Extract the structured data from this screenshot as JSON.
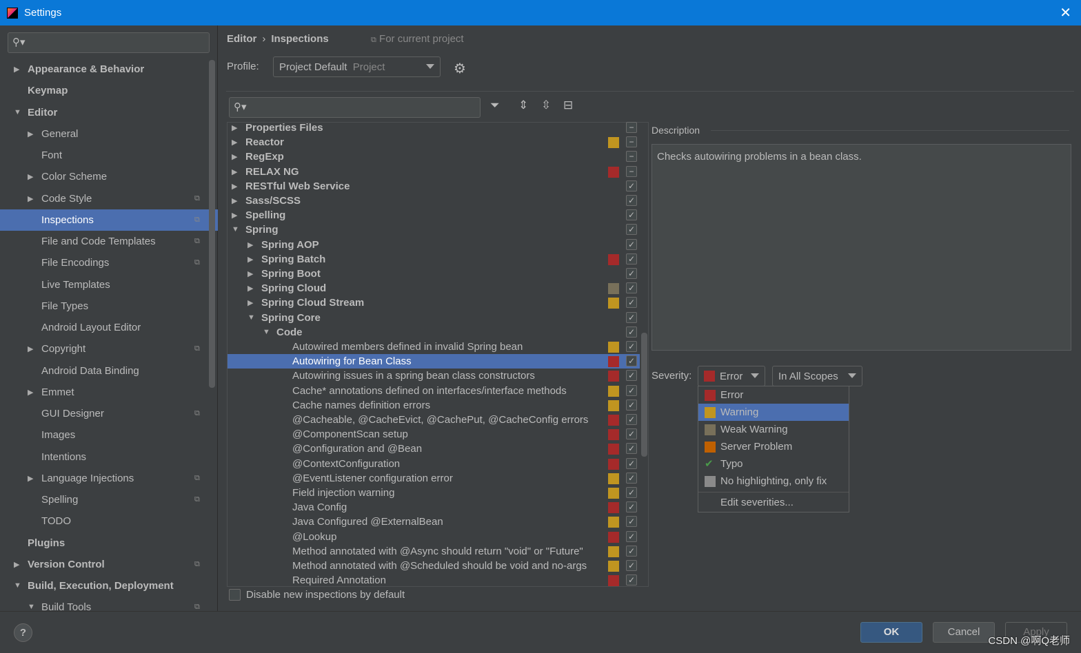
{
  "window": {
    "title": "Settings"
  },
  "colors": {
    "error": "#a52a2a",
    "warning": "#c09520",
    "weak_warning": "#78705a",
    "server_problem": "#c06000",
    "no_highlight": "#8a8a8a",
    "typo": "#4a9a4a",
    "selection": "#4b6eaf",
    "titlebar": "#0a78d7"
  },
  "sidebar": {
    "items": [
      {
        "label": "Appearance & Behavior",
        "level": 0,
        "arrow": "right",
        "bold": true
      },
      {
        "label": "Keymap",
        "level": 0,
        "bold": true
      },
      {
        "label": "Editor",
        "level": 0,
        "arrow": "down",
        "bold": true
      },
      {
        "label": "General",
        "level": 1,
        "arrow": "right"
      },
      {
        "label": "Font",
        "level": 1
      },
      {
        "label": "Color Scheme",
        "level": 1,
        "arrow": "right"
      },
      {
        "label": "Code Style",
        "level": 1,
        "arrow": "right",
        "project": true
      },
      {
        "label": "Inspections",
        "level": 1,
        "project": true,
        "selected": true
      },
      {
        "label": "File and Code Templates",
        "level": 1,
        "project": true
      },
      {
        "label": "File Encodings",
        "level": 1,
        "project": true
      },
      {
        "label": "Live Templates",
        "level": 1
      },
      {
        "label": "File Types",
        "level": 1
      },
      {
        "label": "Android Layout Editor",
        "level": 1
      },
      {
        "label": "Copyright",
        "level": 1,
        "arrow": "right",
        "project": true
      },
      {
        "label": "Android Data Binding",
        "level": 1
      },
      {
        "label": "Emmet",
        "level": 1,
        "arrow": "right"
      },
      {
        "label": "GUI Designer",
        "level": 1,
        "project": true
      },
      {
        "label": "Images",
        "level": 1
      },
      {
        "label": "Intentions",
        "level": 1
      },
      {
        "label": "Language Injections",
        "level": 1,
        "arrow": "right",
        "project": true
      },
      {
        "label": "Spelling",
        "level": 1,
        "project": true
      },
      {
        "label": "TODO",
        "level": 1
      },
      {
        "label": "Plugins",
        "level": 0,
        "bold": true
      },
      {
        "label": "Version Control",
        "level": 0,
        "arrow": "right",
        "bold": true,
        "project": true
      },
      {
        "label": "Build, Execution, Deployment",
        "level": 0,
        "arrow": "down",
        "bold": true
      },
      {
        "label": "Build Tools",
        "level": 1,
        "arrow": "down",
        "project": true
      }
    ]
  },
  "header": {
    "breadcrumb": [
      "Editor",
      "Inspections"
    ],
    "for_project": "For current project",
    "profile_label": "Profile:",
    "profile_value": "Project Default",
    "profile_scope": "Project"
  },
  "tree": {
    "rows": [
      {
        "label": "Properties Files",
        "level": 0,
        "arrow": "right",
        "bold": true,
        "check": "minus"
      },
      {
        "label": "Reactor",
        "level": 0,
        "arrow": "right",
        "bold": true,
        "sev": "warning",
        "check": "minus"
      },
      {
        "label": "RegExp",
        "level": 0,
        "arrow": "right",
        "bold": true,
        "check": "minus"
      },
      {
        "label": "RELAX NG",
        "level": 0,
        "arrow": "right",
        "bold": true,
        "sev": "error",
        "check": "minus"
      },
      {
        "label": "RESTful Web Service",
        "level": 0,
        "arrow": "right",
        "bold": true,
        "check": "checked"
      },
      {
        "label": "Sass/SCSS",
        "level": 0,
        "arrow": "right",
        "bold": true,
        "check": "checked"
      },
      {
        "label": "Spelling",
        "level": 0,
        "arrow": "right",
        "bold": true,
        "check": "checked"
      },
      {
        "label": "Spring",
        "level": 0,
        "arrow": "down",
        "bold": true,
        "check": "checked"
      },
      {
        "label": "Spring AOP",
        "level": 1,
        "arrow": "right",
        "bold": true,
        "check": "checked"
      },
      {
        "label": "Spring Batch",
        "level": 1,
        "arrow": "right",
        "bold": true,
        "sev": "error",
        "check": "checked"
      },
      {
        "label": "Spring Boot",
        "level": 1,
        "arrow": "right",
        "bold": true,
        "check": "checked"
      },
      {
        "label": "Spring Cloud",
        "level": 1,
        "arrow": "right",
        "bold": true,
        "sev": "weak_warning",
        "check": "checked"
      },
      {
        "label": "Spring Cloud Stream",
        "level": 1,
        "arrow": "right",
        "bold": true,
        "sev": "warning",
        "check": "checked"
      },
      {
        "label": "Spring Core",
        "level": 1,
        "arrow": "down",
        "bold": true,
        "check": "checked"
      },
      {
        "label": "Code",
        "level": 2,
        "arrow": "down",
        "bold": true,
        "check": "checked"
      },
      {
        "label": "Autowired members defined in invalid Spring bean",
        "level": 3,
        "sev": "warning",
        "check": "checked"
      },
      {
        "label": "Autowiring for Bean Class",
        "level": 3,
        "sev": "error",
        "check": "checked",
        "selected": true
      },
      {
        "label": "Autowiring issues in a spring bean class constructors",
        "level": 3,
        "sev": "error",
        "check": "checked"
      },
      {
        "label": "Cache* annotations defined on interfaces/interface methods",
        "level": 3,
        "sev": "warning",
        "check": "checked"
      },
      {
        "label": "Cache names definition errors",
        "level": 3,
        "sev": "warning",
        "check": "checked"
      },
      {
        "label": "@Cacheable, @CacheEvict, @CachePut, @CacheConfig errors",
        "level": 3,
        "sev": "error",
        "check": "checked"
      },
      {
        "label": "@ComponentScan setup",
        "level": 3,
        "sev": "error",
        "check": "checked"
      },
      {
        "label": "@Configuration and @Bean",
        "level": 3,
        "sev": "error",
        "check": "checked"
      },
      {
        "label": "@ContextConfiguration",
        "level": 3,
        "sev": "error",
        "check": "checked"
      },
      {
        "label": "@EventListener configuration error",
        "level": 3,
        "sev": "warning",
        "check": "checked"
      },
      {
        "label": "Field injection warning",
        "level": 3,
        "sev": "warning",
        "check": "checked"
      },
      {
        "label": "Java Config",
        "level": 3,
        "sev": "error",
        "check": "checked"
      },
      {
        "label": "Java Configured @ExternalBean",
        "level": 3,
        "sev": "warning",
        "check": "checked"
      },
      {
        "label": "@Lookup",
        "level": 3,
        "sev": "error",
        "check": "checked"
      },
      {
        "label": "Method annotated with @Async should return \"void\" or \"Future\"",
        "level": 3,
        "sev": "warning",
        "check": "checked"
      },
      {
        "label": "Method annotated with @Scheduled should be void and no-args",
        "level": 3,
        "sev": "warning",
        "check": "checked"
      },
      {
        "label": "Required Annotation",
        "level": 3,
        "sev": "error",
        "check": "checked"
      }
    ]
  },
  "description": {
    "title": "Description",
    "text": "Checks autowiring problems in a bean class."
  },
  "severity": {
    "label": "Severity:",
    "value": "Error",
    "scope": "In All Scopes",
    "options": [
      {
        "label": "Error",
        "sev": "error"
      },
      {
        "label": "Warning",
        "sev": "warning",
        "highlighted": true
      },
      {
        "label": "Weak Warning",
        "sev": "weak_warning"
      },
      {
        "label": "Server Problem",
        "sev": "server_problem"
      },
      {
        "label": "Typo",
        "sev": "typo"
      },
      {
        "label": "No highlighting, only fix",
        "sev": "no_highlight"
      }
    ],
    "edit": "Edit severities..."
  },
  "disable_new": "Disable new inspections by default",
  "buttons": {
    "help": "?",
    "ok": "OK",
    "cancel": "Cancel",
    "apply": "Apply"
  },
  "watermark": "CSDN @啊Q老师"
}
